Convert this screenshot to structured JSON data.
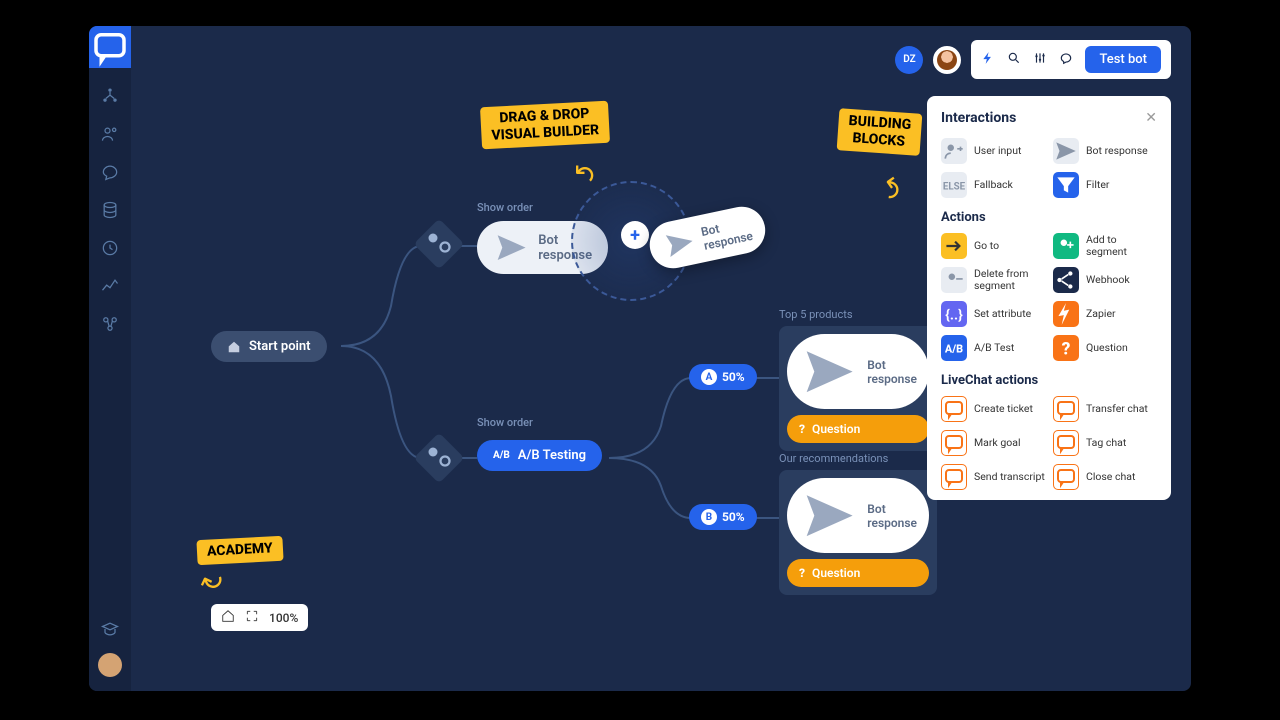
{
  "topbar": {
    "badge": "DZ",
    "testbot": "Test bot"
  },
  "callouts": {
    "drag": "DRAG & DROP\nVISUAL BUILDER",
    "blocks": "BUILDING\nBLOCKS",
    "academy": "ACADEMY"
  },
  "flow": {
    "start": "Start point",
    "showorder1": "Show order",
    "showorder2": "Show order",
    "botresponse": "Bot response",
    "abtesting": "A/B Testing",
    "dragging": "Bot response",
    "chipA": {
      "letter": "A",
      "pct": "50%"
    },
    "chipB": {
      "letter": "B",
      "pct": "50%"
    },
    "card1": {
      "label": "Top 5 products",
      "r1": "Bot response",
      "r2": "Question"
    },
    "card2": {
      "label": "Our recommendations",
      "r1": "Bot response",
      "r2": "Question"
    }
  },
  "zoom": {
    "value": "100%"
  },
  "panel": {
    "title": "Interactions",
    "sec1": [
      {
        "label": "User input",
        "icon": "user",
        "cls": "i-gray"
      },
      {
        "label": "Bot response",
        "icon": "send",
        "cls": "i-gray"
      },
      {
        "label": "Fallback",
        "icon": "else",
        "cls": "i-gray"
      },
      {
        "label": "Filter",
        "icon": "filter",
        "cls": "i-blue"
      }
    ],
    "actions_title": "Actions",
    "sec2": [
      {
        "label": "Go to",
        "icon": "arrow",
        "cls": "i-yellow"
      },
      {
        "label": "Add to segment",
        "icon": "plus-user",
        "cls": "i-green"
      },
      {
        "label": "Delete from segment",
        "icon": "minus-user",
        "cls": "i-gray"
      },
      {
        "label": "Webhook",
        "icon": "share",
        "cls": "i-dark"
      },
      {
        "label": "Set attribute",
        "icon": "brackets",
        "cls": "i-purple"
      },
      {
        "label": "Zapier",
        "icon": "zap",
        "cls": "i-orange"
      },
      {
        "label": "A/B Test",
        "icon": "ab",
        "cls": "i-blue"
      },
      {
        "label": "Question",
        "icon": "q",
        "cls": "i-orange"
      }
    ],
    "lc_title": "LiveChat actions",
    "sec3": [
      {
        "label": "Create ticket",
        "icon": "chat",
        "cls": "i-orange-out"
      },
      {
        "label": "Transfer chat",
        "icon": "chat",
        "cls": "i-orange-out"
      },
      {
        "label": "Mark goal",
        "icon": "chat",
        "cls": "i-orange-out"
      },
      {
        "label": "Tag chat",
        "icon": "chat",
        "cls": "i-orange-out"
      },
      {
        "label": "Send transcript",
        "icon": "chat",
        "cls": "i-orange-out"
      },
      {
        "label": "Close chat",
        "icon": "chat",
        "cls": "i-orange-out"
      }
    ]
  }
}
